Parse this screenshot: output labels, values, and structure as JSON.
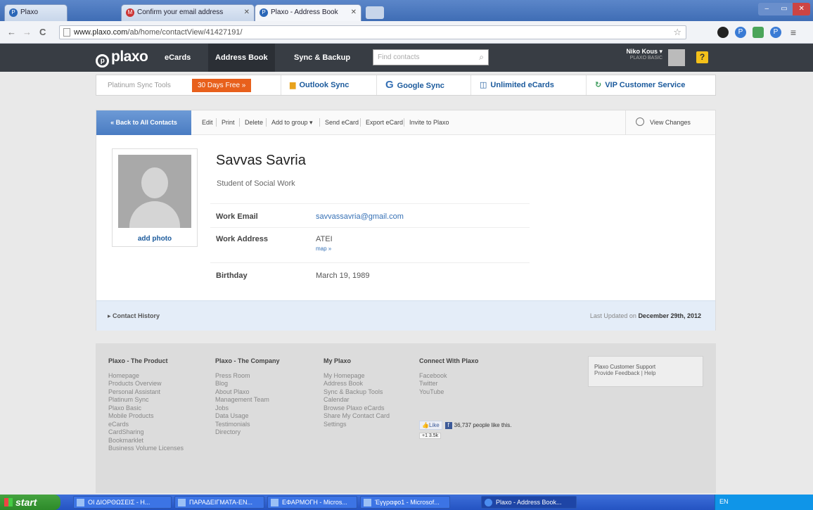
{
  "browser": {
    "tabs": [
      {
        "label": "Plaxo",
        "favicon": "P"
      },
      {
        "label": "Confirm your email address",
        "favicon": "M"
      },
      {
        "label": "Plaxo - Address Book",
        "favicon": "P"
      }
    ],
    "url_host": "www.plaxo.com",
    "url_path": "/ab/home/contactView/41427191/"
  },
  "header": {
    "logo": "plaxo",
    "nav": [
      "eCards",
      "Address Book",
      "Sync & Backup"
    ],
    "search_placeholder": "Find contacts",
    "user_name": "Niko Kous",
    "user_sub": "PLAXO BASIC",
    "help": "?"
  },
  "syncbar": {
    "label": "Platinum Sync Tools",
    "days_free": "30 Days Free »",
    "links": [
      "Outlook Sync",
      "Google Sync",
      "Unlimited eCards",
      "VIP Customer Service"
    ]
  },
  "toolbar": {
    "back": "« Back to All Contacts",
    "actions": [
      "Edit",
      "Print",
      "Delete",
      "Add to group ▾",
      "Send eCard",
      "Export eCard",
      "Invite to Plaxo"
    ],
    "view_changes": "View Changes"
  },
  "contact": {
    "name": "Savvas Savria",
    "title": "Student of Social Work",
    "add_photo": "add photo",
    "work_email_label": "Work Email",
    "work_email": "savvassavria@gmail.com",
    "work_address_label": "Work Address",
    "work_address": "ATEI",
    "map_link": "map »",
    "birthday_label": "Birthday",
    "birthday": "March 19, 1989"
  },
  "history": {
    "label": "▸ Contact History",
    "updated_prefix": "Last Updated on ",
    "updated_date": "December 29th, 2012"
  },
  "footer": {
    "columns": [
      {
        "title": "Plaxo - The Product",
        "items": [
          "Homepage",
          "Products Overview",
          "Personal Assistant",
          "Platinum Sync",
          "Plaxo Basic",
          "Mobile Products",
          "eCards",
          "CardSharing",
          "Bookmarklet",
          "Business Volume Licenses"
        ]
      },
      {
        "title": "Plaxo - The Company",
        "items": [
          "Press Room",
          "Blog",
          "About Plaxo",
          "Management Team",
          "Jobs",
          "Data Usage",
          "Testimonials",
          "Directory"
        ]
      },
      {
        "title": "My Plaxo",
        "items": [
          "My Homepage",
          "Address Book",
          "Sync & Backup Tools",
          "Calendar",
          "Browse Plaxo eCards",
          "Share My Contact Card",
          "Settings"
        ]
      },
      {
        "title": "Connect With Plaxo",
        "items": [
          "Facebook",
          "Twitter",
          "YouTube"
        ]
      }
    ],
    "support_title": "Plaxo Customer Support",
    "support_links": "Provide Feedback | Help",
    "like_label": "Like",
    "like_count": "36,737 people like this.",
    "gplus_count": "+1   3.5k"
  },
  "taskbar": {
    "start": "start",
    "items": [
      "ΟΙ ΔΙΟΡΘΩΣΕΙΣ - Η...",
      "ΠΑΡΑΔΕΙΓΜΑΤΑ-ΕΝ...",
      "ΕΦΑΡΜΟΓΗ - Micros...",
      "Έγγραφο1 - Microsof...",
      "Plaxo - Address Book..."
    ],
    "lang": "EN"
  }
}
